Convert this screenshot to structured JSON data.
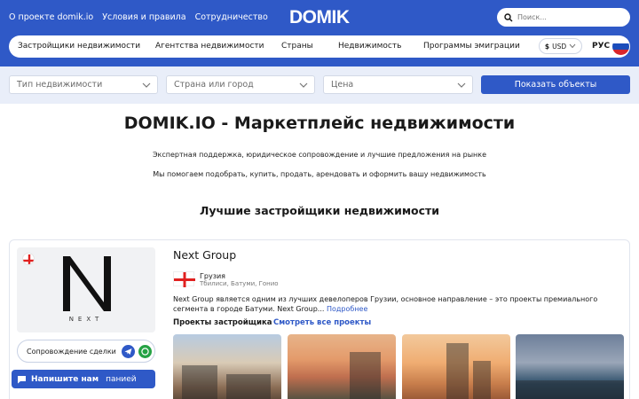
{
  "header": {
    "links": [
      "О проекте domik.io",
      "Условия и правила",
      "Сотрудничество"
    ],
    "logo": "DOMIK",
    "search_placeholder": "Поиск..."
  },
  "nav": {
    "items": [
      "Застройщики недвижимости",
      "Агентства недвижимости",
      "Страны",
      "Недвижимость",
      "Программы эмиграции"
    ],
    "currency_symbol": "$",
    "currency": "USD",
    "language": "РУС"
  },
  "filters": {
    "property_type": "Тип недвижимости",
    "location": "Страна или город",
    "price": "Цена",
    "submit": "Показать объекты"
  },
  "hero": {
    "title": "DOMIK.IO - Маркетплейс недвижимости",
    "subtitle1": "Экспертная поддержка, юридическое сопровождение и лучшие предложения на рынке",
    "subtitle2": "Мы помогаем подобрать, купить, продать, арендовать  и оформить вашу недвижимость"
  },
  "section": {
    "heading": "Лучшие застройщики недвижимости"
  },
  "developer": {
    "logo_text": "NEXT",
    "name": "Next Group",
    "country": "Грузия",
    "cities": "Тбилиси, Батуми, Гонио",
    "description": "Next Group является одним из лучших девелоперов Грузии, основное направление – это проекты премиального сегмента в городе Батуми. Next Group...",
    "more": "Подробнее",
    "projects_label": "Проекты застройщика",
    "all_projects": "Смотреть все проекты",
    "escort_label": "Сопровождение сделки",
    "write_us": "Напишите нам",
    "write_us_rest": "панией"
  },
  "icons": {
    "search": "search-icon",
    "chevron": "chevron-down-icon",
    "telegram": "telegram-icon",
    "whatsapp": "whatsapp-icon",
    "chat": "chat-icon"
  },
  "colors": {
    "brand": "#2f59c7",
    "filter_bg": "#e9eef9"
  }
}
